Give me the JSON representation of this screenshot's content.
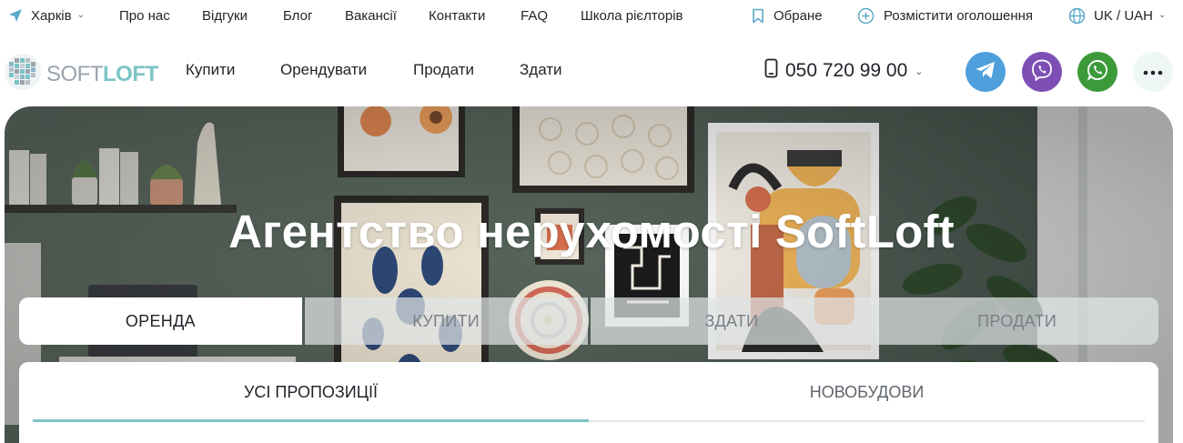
{
  "topbar": {
    "city": "Харків",
    "links": [
      "Про нас",
      "Відгуки",
      "Блог",
      "Вакансії",
      "Контакти",
      "FAQ",
      "Школа рієлторів"
    ],
    "favorites": "Обране",
    "post_ad": "Розмістити оголошення",
    "locale": "UK / UAH"
  },
  "nav": {
    "logo_soft": "SOFT",
    "logo_loft": "LOFT",
    "links": [
      "Купити",
      "Орендувати",
      "Продати",
      "Здати"
    ],
    "phone": "050 720 99 00",
    "social": [
      {
        "icon": "telegram-icon",
        "color": "#4f9fdc"
      },
      {
        "icon": "viber-icon",
        "color": "#7d4fb5"
      },
      {
        "icon": "whatsapp-icon",
        "color": "#3c9a3a"
      },
      {
        "icon": "more-icon",
        "color": "#eef6f6"
      }
    ]
  },
  "hero": {
    "title": "Агентство нерухомості SoftLoft",
    "deal_tabs": [
      "ОРЕНДА",
      "КУПИТИ",
      "ЗДАТИ",
      "ПРОДАТИ"
    ],
    "active_deal_tab": "ОРЕНДА",
    "sub_tabs": [
      "УСІ ПРОПОЗИЦІЇ",
      "НОВОБУДОВИ"
    ],
    "active_sub_tab": "УСІ ПРОПОЗИЦІЇ"
  },
  "colors": {
    "accent": "#7cc4c6",
    "text": "#1f2329",
    "muted": "#5f656c"
  }
}
